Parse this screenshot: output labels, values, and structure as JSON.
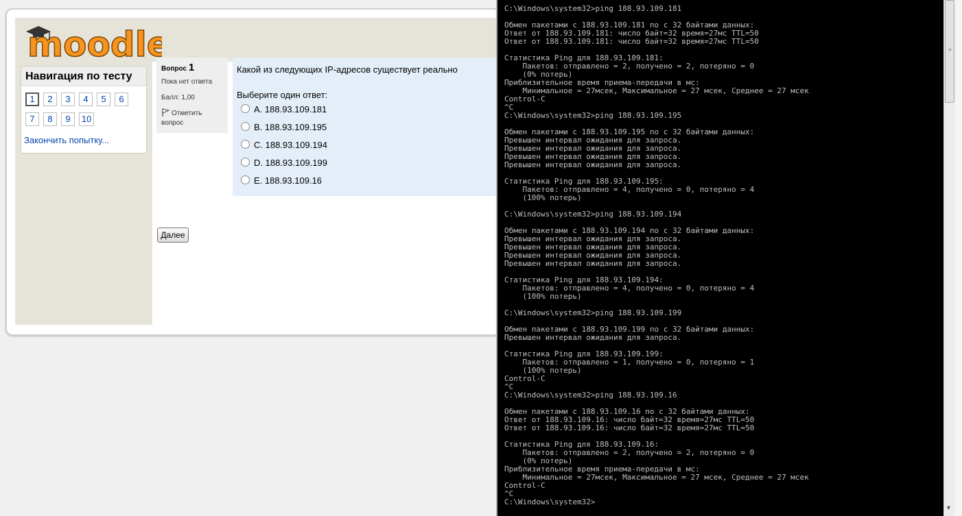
{
  "moodle": {
    "logo_text": "moodle",
    "nav": {
      "title": "Навигация по тесту",
      "questions": [
        "1",
        "2",
        "3",
        "4",
        "5",
        "6",
        "7",
        "8",
        "9",
        "10"
      ],
      "finish_link": "Закончить попытку..."
    },
    "question": {
      "label": "Вопрос",
      "number": "1",
      "state": "Пока нет ответа",
      "grade": "Балл: 1,00",
      "flag_label": "Отметить вопрос",
      "text": "Какой из следующих IP-адресов существует реально",
      "prompt": "Выберите один ответ:",
      "answers": [
        "A. 188.93.109.181",
        "B. 188.93.109.195",
        "C. 188.93.109.194",
        "D. 188.93.109.199",
        "E. 188.93.109.16"
      ]
    },
    "next_label": "Далее"
  },
  "console": {
    "lines": [
      "",
      "C:\\Windows\\system32>ping 188.93.109.181",
      "",
      "Обмен пакетами с 188.93.109.181 по с 32 байтами данных:",
      "Ответ от 188.93.109.181: число байт=32 время=27мс TTL=50",
      "Ответ от 188.93.109.181: число байт=32 время=27мс TTL=50",
      "",
      "Статистика Ping для 188.93.109.181:",
      "    Пакетов: отправлено = 2, получено = 2, потеряно = 0",
      "    (0% потерь)",
      "Приблизительное время приема-передачи в мс:",
      "    Минимальное = 27мсек, Максимальное = 27 мсек, Среднее = 27 мсек",
      "Control-C",
      "^C",
      "C:\\Windows\\system32>ping 188.93.109.195",
      "",
      "Обмен пакетами с 188.93.109.195 по с 32 байтами данных:",
      "Превышен интервал ожидания для запроса.",
      "Превышен интервал ожидания для запроса.",
      "Превышен интервал ожидания для запроса.",
      "Превышен интервал ожидания для запроса.",
      "",
      "Статистика Ping для 188.93.109.195:",
      "    Пакетов: отправлено = 4, получено = 0, потеряно = 4",
      "    (100% потерь)",
      "",
      "C:\\Windows\\system32>ping 188.93.109.194",
      "",
      "Обмен пакетами с 188.93.109.194 по с 32 байтами данных:",
      "Превышен интервал ожидания для запроса.",
      "Превышен интервал ожидания для запроса.",
      "Превышен интервал ожидания для запроса.",
      "Превышен интервал ожидания для запроса.",
      "",
      "Статистика Ping для 188.93.109.194:",
      "    Пакетов: отправлено = 4, получено = 0, потеряно = 4",
      "    (100% потерь)",
      "",
      "C:\\Windows\\system32>ping 188.93.109.199",
      "",
      "Обмен пакетами с 188.93.109.199 по с 32 байтами данных:",
      "Превышен интервал ожидания для запроса.",
      "",
      "Статистика Ping для 188.93.109.199:",
      "    Пакетов: отправлено = 1, получено = 0, потеряно = 1",
      "    (100% потерь)",
      "Control-C",
      "^C",
      "C:\\Windows\\system32>ping 188.93.109.16",
      "",
      "Обмен пакетами с 188.93.109.16 по с 32 байтами данных:",
      "Ответ от 188.93.109.16: число байт=32 время=27мс TTL=50",
      "Ответ от 188.93.109.16: число байт=32 время=27мс TTL=50",
      "",
      "Статистика Ping для 188.93.109.16:",
      "    Пакетов: отправлено = 2, получено = 2, потеряно = 0",
      "    (0% потерь)",
      "Приблизительное время приема-передачи в мс:",
      "    Минимальное = 27мсек, Максимальное = 27 мсек, Среднее = 27 мсек",
      "Control-C",
      "^C",
      "C:\\Windows\\system32>"
    ]
  }
}
